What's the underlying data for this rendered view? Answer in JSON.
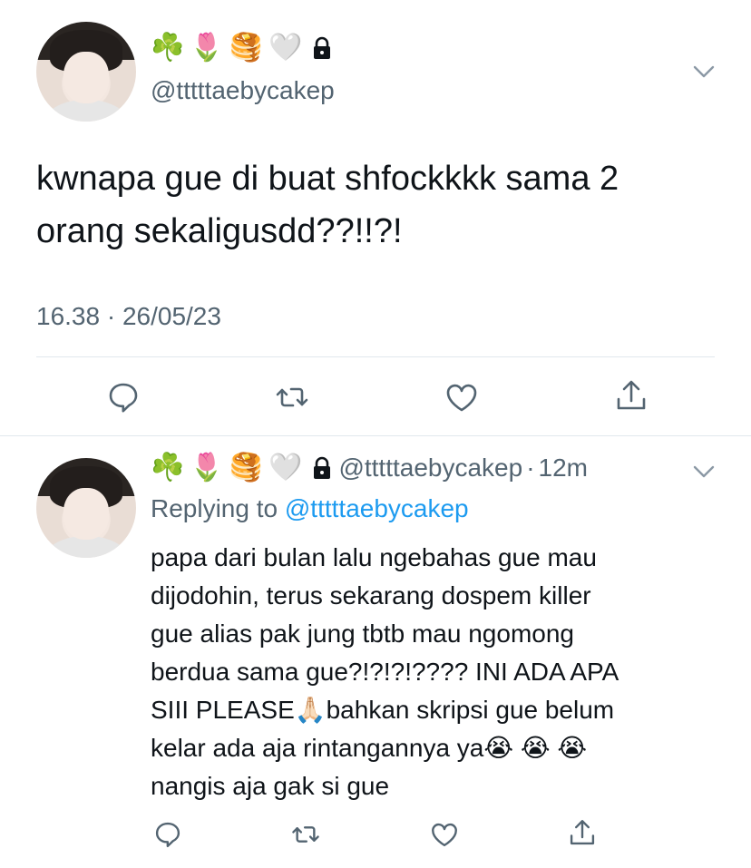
{
  "main_tweet": {
    "name_emojis": [
      "☘️",
      "🌷",
      "🥞",
      "🤍"
    ],
    "lock_icon": "lock-icon",
    "handle": "@tttttaebycakep",
    "text_line1": "kwnapa gue di buat shfockkkk sama 2",
    "text_line2": "orang sekaligusdd??!!?!",
    "timestamp": "16.38 · 26/05/23",
    "actions": [
      "reply-icon",
      "retweet-icon",
      "like-icon",
      "share-icon"
    ]
  },
  "reply_tweet": {
    "name_emojis": [
      "☘️",
      "🌷",
      "🥞",
      "🤍"
    ],
    "lock_icon": "lock-icon",
    "handle": "@tttttaebycakep",
    "separator": "·",
    "time_ago": "12m",
    "replying_label": "Replying to ",
    "replying_handle": "@tttttaebycakep",
    "lines": [
      "papa dari bulan lalu ngebahas gue mau",
      "dijodohin, terus sekarang dospem killer",
      "gue alias pak jung tbtb mau ngomong",
      "berdua sama gue?!?!?!???? INI ADA APA",
      "SIII PLEASE🙏🏻bahkan skripsi gue belum",
      "kelar ada aja rintangannya ya😭 😭 😭",
      "nangis aja gak si gue"
    ],
    "actions": [
      "reply-icon",
      "retweet-icon",
      "like-icon",
      "share-icon"
    ]
  },
  "colors": {
    "text": "#0f1419",
    "secondary": "#536471",
    "link": "#1d9bf0",
    "divider": "#e1e8ed"
  }
}
